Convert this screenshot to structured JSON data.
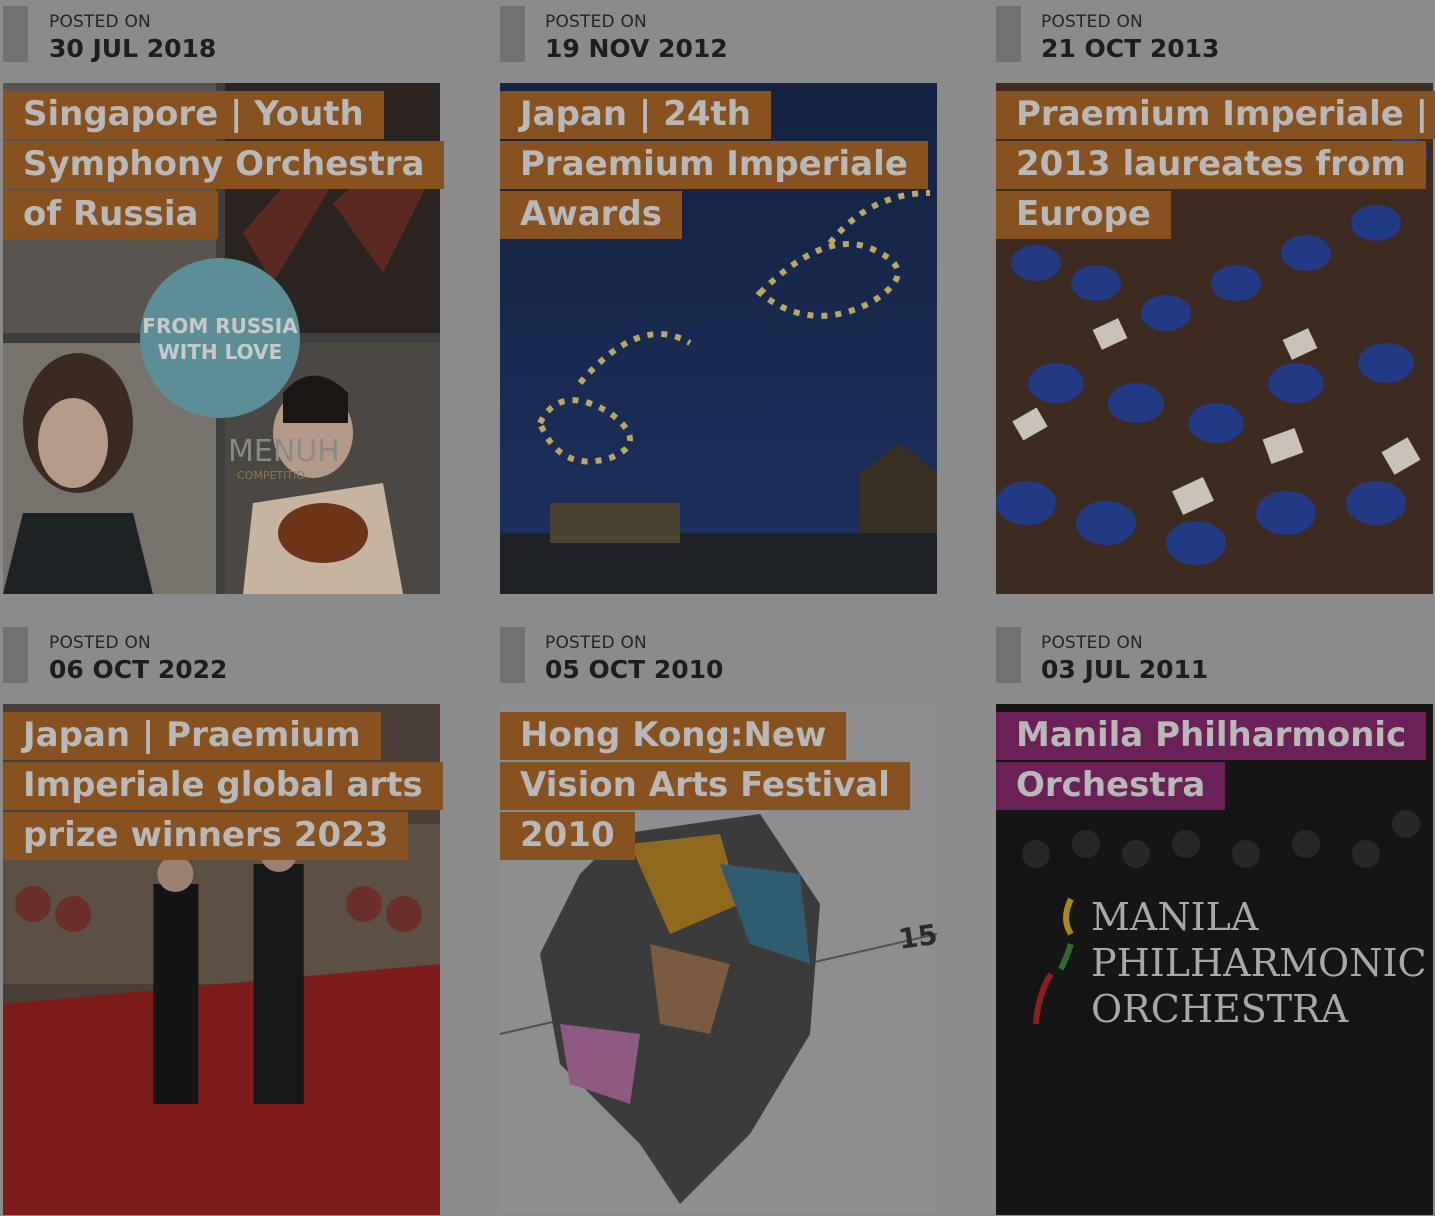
{
  "posts": [
    {
      "posted_label": "POSTED ON",
      "date": "30 JUL 2018",
      "title": "Singapore | Youth Symphony Orchestra of Russia",
      "image_text_1": "FROM RUSSIA",
      "image_text_2": "WITH LOVE",
      "image_text_3": "MENUH",
      "image_text_4": "COMPETITIO"
    },
    {
      "posted_label": "POSTED ON",
      "date": "19 NOV 2012",
      "title": "Japan | 24th Praemium Imperiale Awards"
    },
    {
      "posted_label": "POSTED ON",
      "date": "21 OCT 2013",
      "title": "Praemium Imperiale | 2013 laureates from Europe"
    },
    {
      "posted_label": "POSTED ON",
      "date": "06 OCT 2022",
      "title": "Japan | Praemium Imperiale global arts prize winners 2023"
    },
    {
      "posted_label": "POSTED ON",
      "date": "05 OCT 2010",
      "title": "Hong Kong:New Vision Arts Festival 2010",
      "image_text_1": "15"
    },
    {
      "posted_label": "POSTED ON",
      "date": "03 JUL 2011",
      "title": "Manila Philharmonic Orchestra",
      "image_text_1": "MANILA",
      "image_text_2": "PHILHARMONIC",
      "image_text_3": "ORCHESTRA"
    }
  ],
  "colors": {
    "title_bg": "#875220",
    "title_bg_alt": "#6b2158",
    "overlay": "#8b8b8b"
  }
}
